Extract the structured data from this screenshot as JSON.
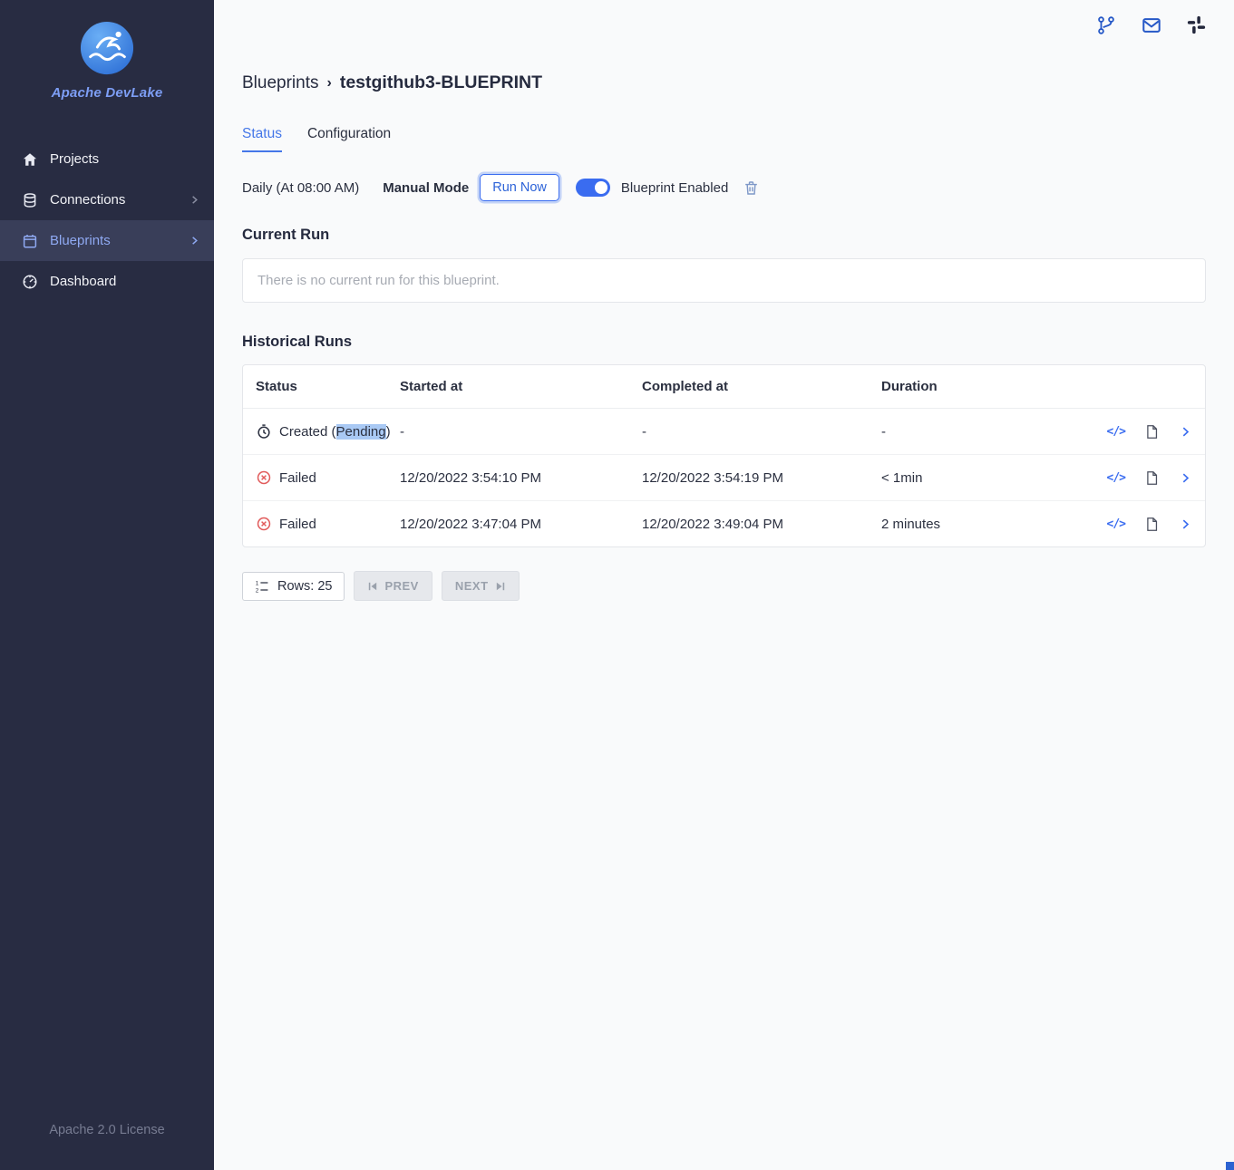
{
  "colors": {
    "accent": "#4577e8",
    "sidebar_bg": "#282c42",
    "danger": "#e15b5b",
    "selection_highlight": "#a9c9f4"
  },
  "sidebar": {
    "logo_title": "Apache DevLake",
    "items": [
      {
        "label": "Projects",
        "icon": "home-icon"
      },
      {
        "label": "Connections",
        "icon": "connections-icon",
        "chevron": true
      },
      {
        "label": "Blueprints",
        "icon": "calendar-icon",
        "chevron": true,
        "active": true
      },
      {
        "label": "Dashboard",
        "icon": "dashboard-icon"
      }
    ],
    "footer": "Apache 2.0 License"
  },
  "topbar": {
    "icons": [
      "version-icon",
      "mail-icon",
      "slack-icon"
    ]
  },
  "breadcrumb": {
    "parent": "Blueprints",
    "separator": "›",
    "current": "testgithub3-BLUEPRINT"
  },
  "tabs": {
    "status": "Status",
    "configuration": "Configuration"
  },
  "controls": {
    "schedule": "Daily (At 08:00 AM)",
    "mode": "Manual Mode",
    "run_now": "Run Now",
    "toggle_label": "Blueprint Enabled"
  },
  "current_run": {
    "heading": "Current Run",
    "empty_message": "There is no current run for this blueprint."
  },
  "historical_runs": {
    "heading": "Historical Runs",
    "columns": {
      "status": "Status",
      "started": "Started at",
      "completed": "Completed at",
      "duration": "Duration"
    },
    "code_icon_text": "</>",
    "rows": [
      {
        "status_prefix": "Created (",
        "status_selected": "Pending",
        "status_suffix": ")",
        "status_icon": "pending-clock-icon",
        "started": "-",
        "completed": "-",
        "duration": "-"
      },
      {
        "status": "Failed",
        "status_icon": "failed-icon",
        "started": "12/20/2022 3:54:10 PM",
        "completed": "12/20/2022 3:54:19 PM",
        "duration": "< 1min"
      },
      {
        "status": "Failed",
        "status_icon": "failed-icon",
        "started": "12/20/2022 3:47:04 PM",
        "completed": "12/20/2022 3:49:04 PM",
        "duration": "2 minutes"
      }
    ]
  },
  "pagination": {
    "rows": "Rows: 25",
    "prev": "PREV",
    "next": "NEXT"
  }
}
